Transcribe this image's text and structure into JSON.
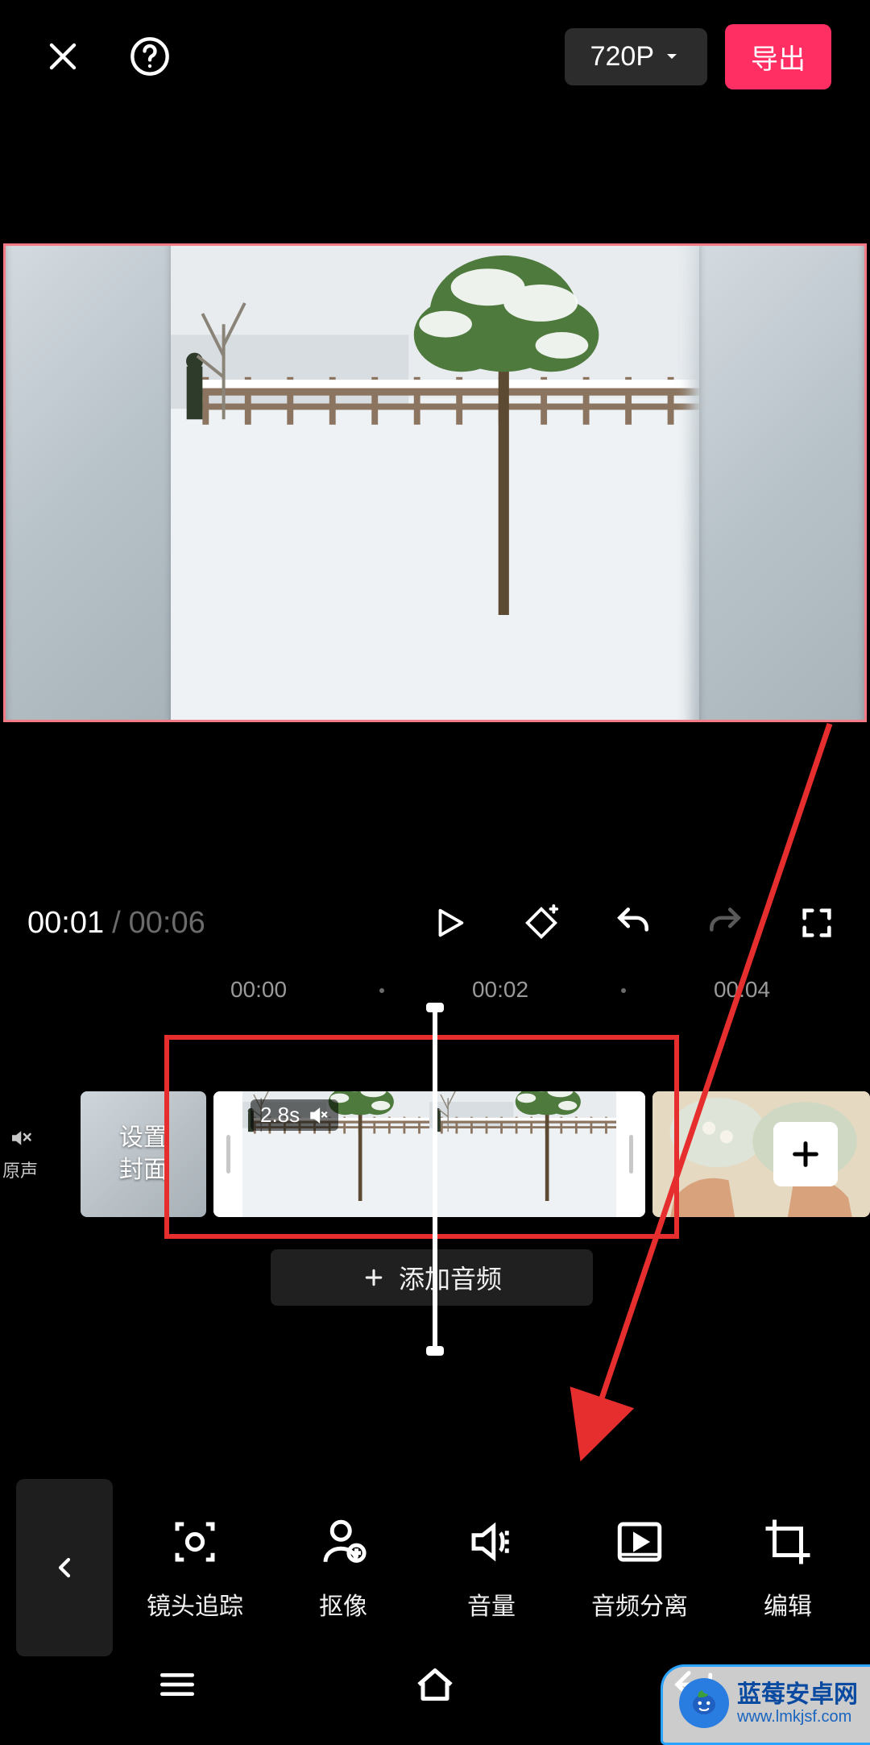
{
  "topbar": {
    "resolution_label": "720P",
    "export_label": "导出"
  },
  "playback": {
    "current_time": "00:01",
    "separator": "/",
    "duration": "00:06"
  },
  "ruler": {
    "marks": [
      "00:00",
      "00:02",
      "00:04"
    ]
  },
  "timeline": {
    "original_sound_label": "原声",
    "cover_label_line1": "设置",
    "cover_label_line2": "封面",
    "clip_duration_badge": "2.8s",
    "add_audio_label": "添加音频"
  },
  "toolbar": {
    "items": [
      {
        "id": "tracking",
        "label": "镜头追踪"
      },
      {
        "id": "cutout",
        "label": "抠像"
      },
      {
        "id": "volume",
        "label": "音量"
      },
      {
        "id": "audio_sep",
        "label": "音频分离"
      },
      {
        "id": "edit",
        "label": "编辑"
      }
    ]
  },
  "watermark": {
    "line1": "蓝莓安卓网",
    "line2": "www.lmkjsf.com"
  },
  "colors": {
    "accent": "#ff2e63",
    "annotation": "#e62e2e",
    "preview_highlight": "#f47a86"
  }
}
